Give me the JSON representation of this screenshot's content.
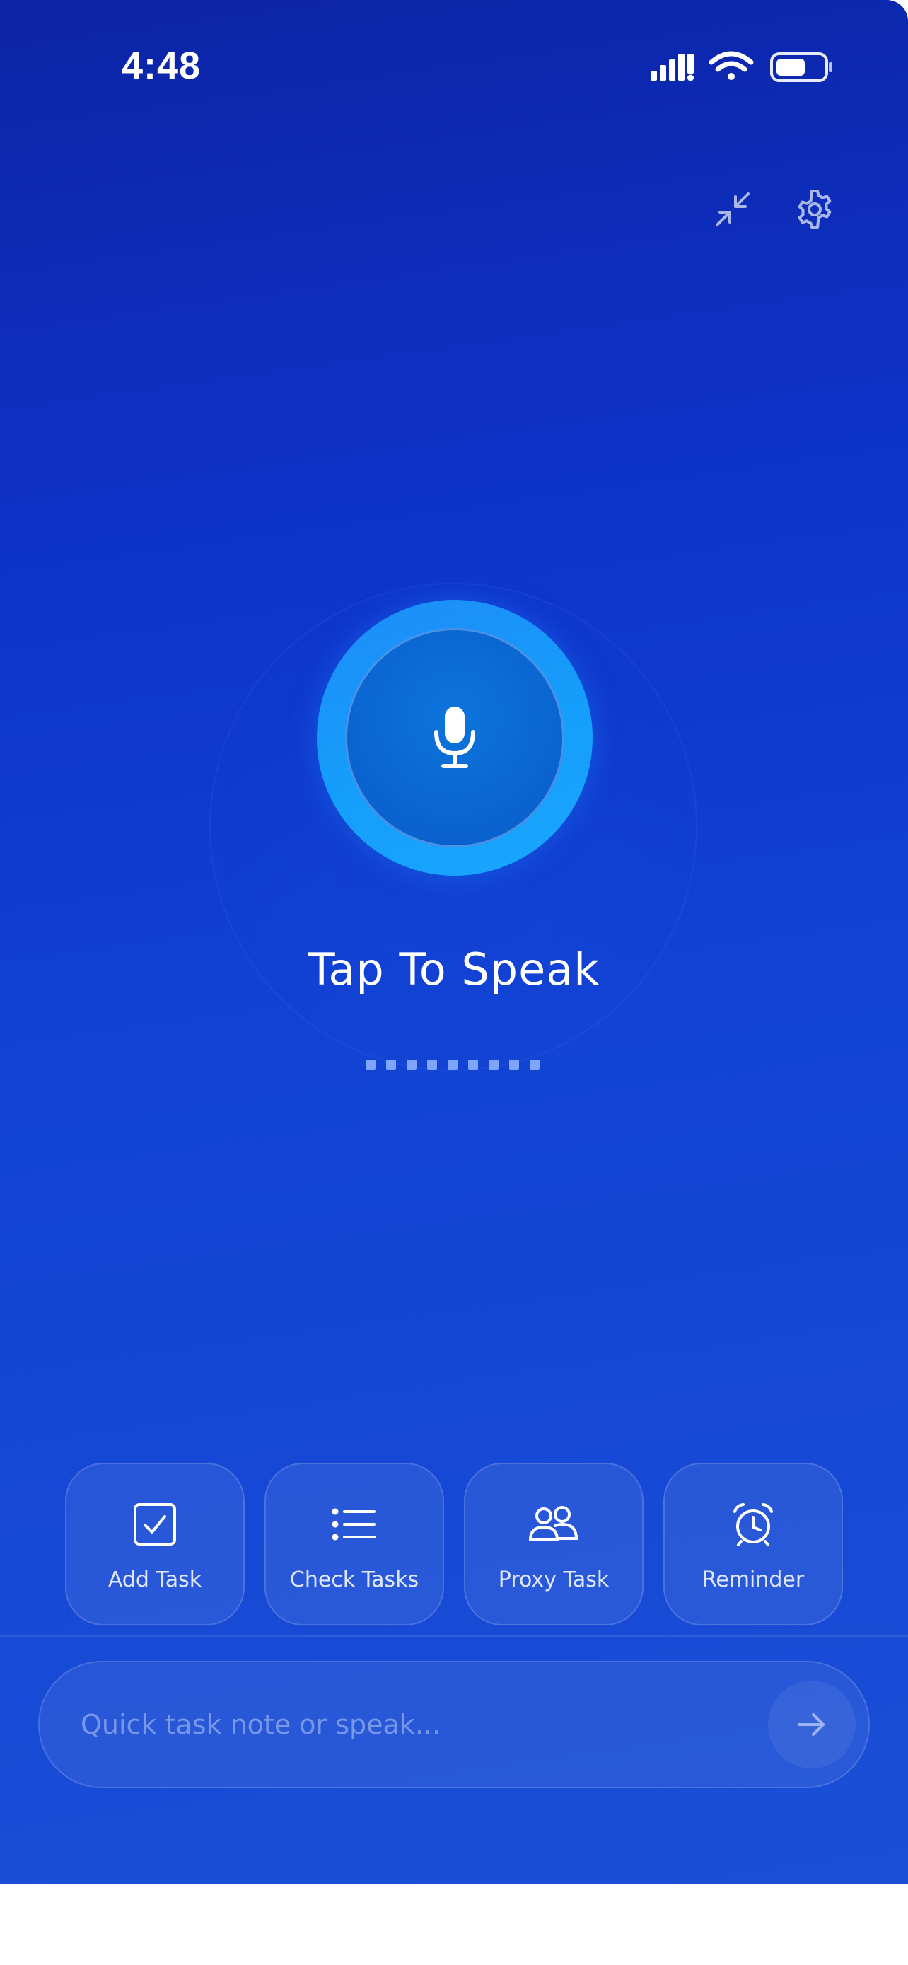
{
  "status_bar": {
    "time": "4:48",
    "icons": [
      "signal-icon",
      "wifi-icon",
      "battery-icon"
    ]
  },
  "top_actions": {
    "collapse_icon": "collapse-icon",
    "settings_icon": "gear-icon"
  },
  "voice": {
    "label": "Tap To Speak",
    "mic_icon": "microphone-icon"
  },
  "quick_actions": [
    {
      "label": "Add Task",
      "icon": "checkbox-icon"
    },
    {
      "label": "Check Tasks",
      "icon": "list-icon"
    },
    {
      "label": "Proxy Task",
      "icon": "users-icon"
    },
    {
      "label": "Reminder",
      "icon": "alarm-clock-icon"
    }
  ],
  "input": {
    "value": "",
    "placeholder": "Quick task note or speak...",
    "send_icon": "arrow-right-icon"
  },
  "colors": {
    "background_top": "#0c24a6",
    "background_bottom": "#1a4fd6",
    "mic_ring": "#159efb",
    "mic_core": "#0a63cf",
    "wave_dots": "#7fa6ff"
  }
}
